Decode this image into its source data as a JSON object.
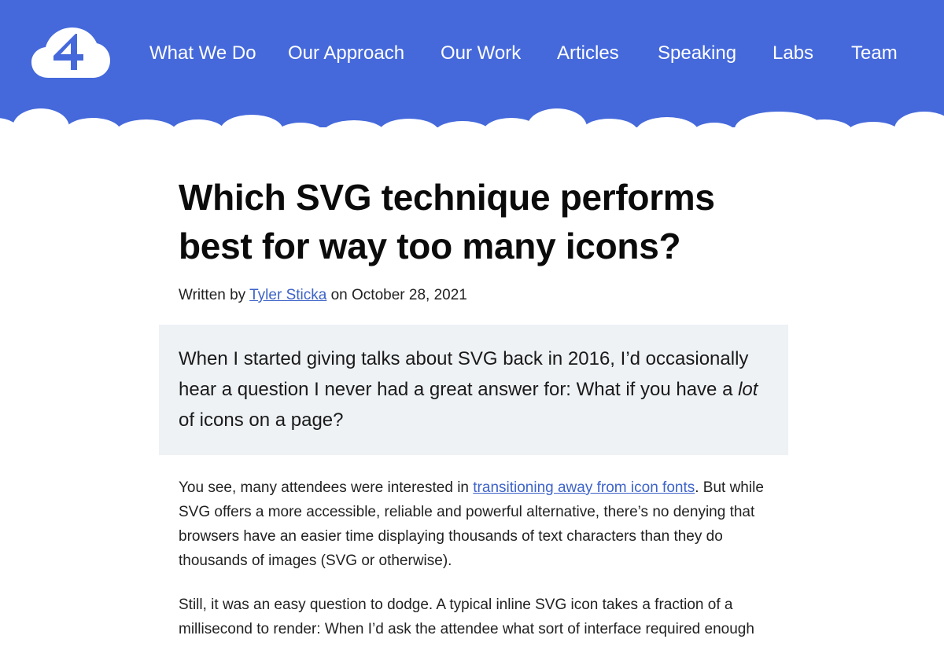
{
  "colors": {
    "header_bg": "#4569db",
    "link": "#3d63c9",
    "intro_bg": "#eef2f5",
    "text": "#222222"
  },
  "header": {
    "logo_icon": "cloud-four-logo-icon",
    "nav": [
      {
        "label": "What We Do"
      },
      {
        "label": "Our Approach"
      },
      {
        "label": "Our Work"
      },
      {
        "label": "Articles"
      },
      {
        "label": "Speaking"
      },
      {
        "label": "Labs"
      },
      {
        "label": "Team"
      }
    ]
  },
  "article": {
    "title_line1": "Which SVG technique performs",
    "title_line2": "best for way too many icons?",
    "byline": {
      "prefix": "Written by ",
      "author": "Tyler Sticka",
      "suffix": " on October 28, 2021"
    },
    "intro": {
      "before": "When I started giving talks about SVG back in 2016, I’d occasionally hear a question I never had a great answer for: What if you have a ",
      "emphasis": "lot",
      "after": " of icons on a page?"
    },
    "paragraph1": {
      "before": "You see, many attendees were interested in ",
      "link": "transitioning away from icon fonts",
      "after": ". But while SVG offers a more accessible, reliable and powerful alternative, there’s no denying that browsers have an easier time displaying thousands of text characters than they do thousands of images (SVG or otherwise)."
    },
    "paragraph2": "Still, it was an easy question to dodge. A typical inline SVG icon takes a fraction of a millisecond to render: When I’d ask the attendee what sort of interface required enough"
  }
}
